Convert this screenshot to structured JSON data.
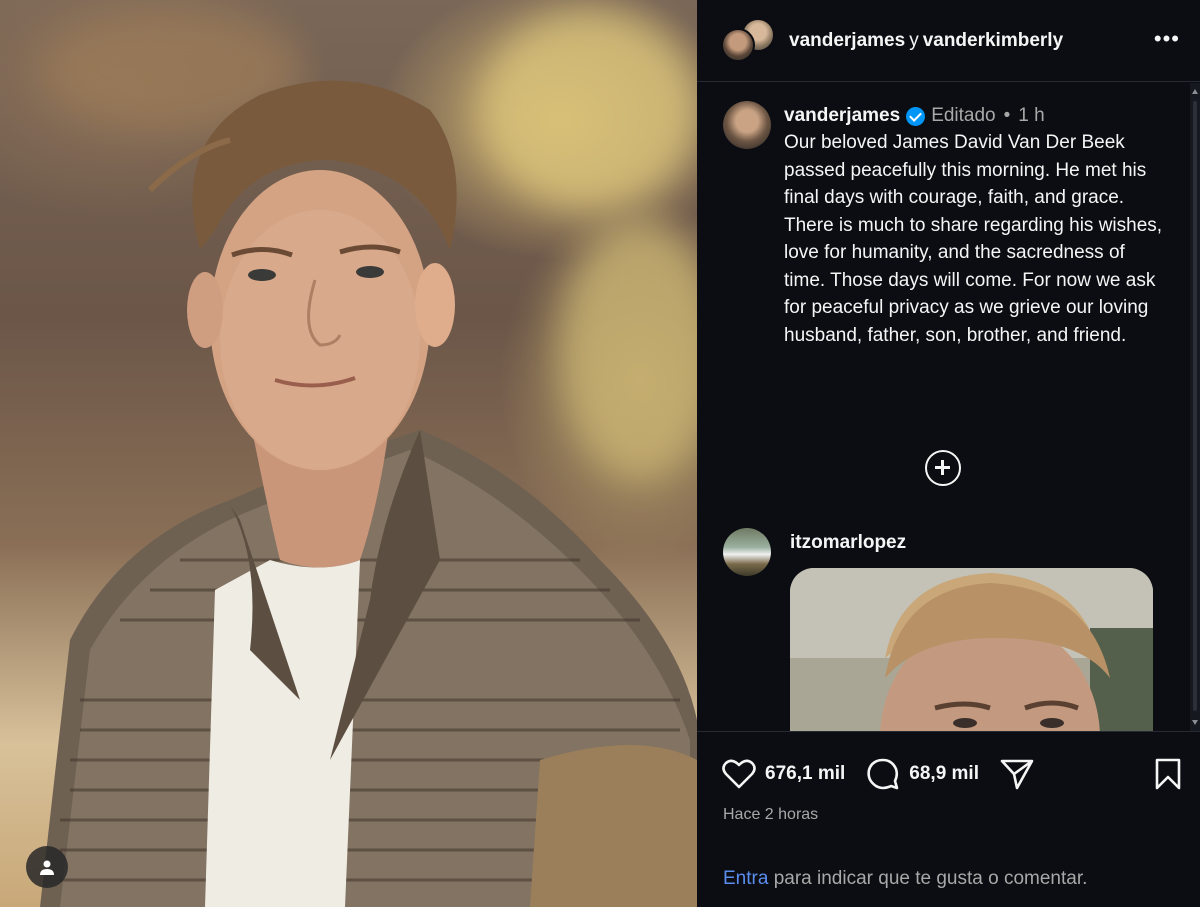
{
  "header": {
    "user_a": "vanderjames",
    "joiner": "y",
    "user_b": "vanderkimberly",
    "more_label": "•••"
  },
  "caption": {
    "username": "vanderjames",
    "edited_label": "Editado",
    "separator": "•",
    "time": "1 h",
    "text": "Our beloved James David Van Der Beek passed peacefully this morning.  He met his final days with courage, faith, and grace.  There is much to share regarding his wishes, love for humanity, and the sacredness of time.  Those days will come.  For now we ask for peaceful privacy as we grieve our loving husband, father, son, brother, and friend."
  },
  "comment": {
    "username": "itzomarlopez"
  },
  "actions": {
    "likes": "676,1 mil",
    "comments": "68,9 mil",
    "posted": "Hace 2 horas"
  },
  "login": {
    "link": "Entra",
    "rest": " para indicar que te gusta o comentar."
  },
  "icons": {
    "like": "heart-icon",
    "comment": "comment-bubble-icon",
    "share": "paper-plane-icon",
    "save": "bookmark-icon",
    "more_comments": "plus-circle-icon",
    "tag_user": "person-icon",
    "verified": "verified-badge-icon"
  },
  "colors": {
    "background": "#0b0d12",
    "verified": "#0095f6",
    "link": "#5a8dee",
    "muted_text": "#a8a8a8"
  }
}
